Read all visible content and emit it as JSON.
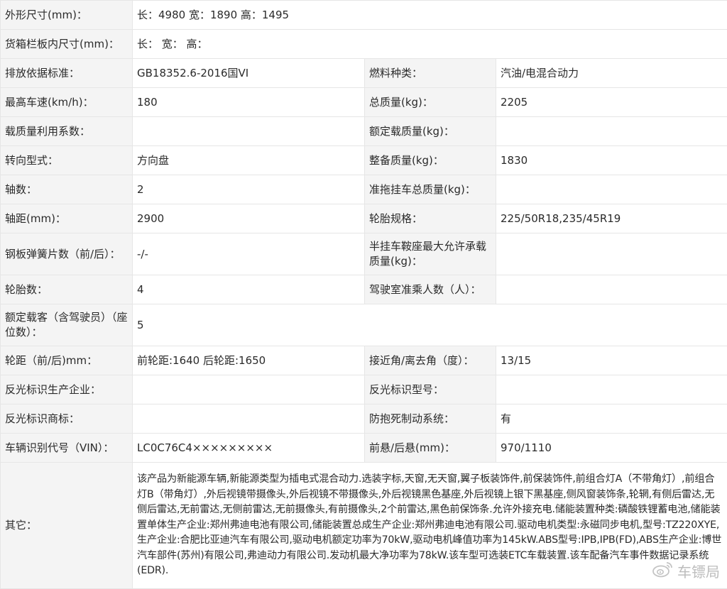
{
  "rows": [
    {
      "l1": "外形尺寸(mm)：",
      "v1": "长：4980 宽：1890 高：1495"
    },
    {
      "l1": "货箱栏板内尺寸(mm)：",
      "v1": "长：  宽：  高："
    },
    {
      "l1": "排放依据标准：",
      "v1": "GB18352.6-2016国VI",
      "l2": "燃料种类：",
      "v2": "汽油/电混合动力"
    },
    {
      "l1": "最高车速(km/h)：",
      "v1": "180",
      "l2": "总质量(kg)：",
      "v2": "2205"
    },
    {
      "l1": "载质量利用系数：",
      "v1": "",
      "l2": "额定载质量(kg)：",
      "v2": ""
    },
    {
      "l1": "转向型式：",
      "v1": "方向盘",
      "l2": "整备质量(kg)：",
      "v2": "1830"
    },
    {
      "l1": "轴数：",
      "v1": "2",
      "l2": "准拖挂车总质量(kg)：",
      "v2": ""
    },
    {
      "l1": "轴距(mm)：",
      "v1": "2900",
      "l2": "轮胎规格：",
      "v2": "225/50R18,235/45R19"
    },
    {
      "l1": "钢板弹簧片数（前/后）：",
      "v1": "-/-",
      "l2": "半挂车鞍座最大允许承载质量(kg)：",
      "v2": ""
    },
    {
      "l1": "轮胎数：",
      "v1": "4",
      "l2": "驾驶室准乘人数（人）：",
      "v2": ""
    },
    {
      "l1": "额定载客（含驾驶员）（座位数）：",
      "v1": "5"
    },
    {
      "l1": "轮距（前/后)mm：",
      "v1": "前轮距:1640 后轮距:1650",
      "l2": "接近角/离去角（度）：",
      "v2": "13/15"
    },
    {
      "l1": "反光标识生产企业：",
      "v1": "",
      "l2": "反光标识型号：",
      "v2": ""
    },
    {
      "l1": "反光标识商标：",
      "v1": "",
      "l2": "防抱死制动系统：",
      "v2": "有"
    },
    {
      "l1": "车辆识别代号（VIN）：",
      "v1": "LC0C76C4×××××××××",
      "l2": "前悬/后悬(mm)：",
      "v2": "970/1110"
    },
    {
      "l1": "其它：",
      "v1": "该产品为新能源车辆,新能源类型为插电式混合动力.选装字标,天窗,无天窗,翼子板装饰件,前保装饰件,前组合灯A（不带角灯）,前组合灯B（带角灯）,外后视镜带摄像头,外后视镜不带摄像头,外后视镜黑色基座,外后视镜上银下黑基座,侧风窗装饰条,轮辋,有侧后雷达,无侧后雷达,无前雷达,无侧前雷达,无前摄像头,有前摄像头,2个前雷达,黑色前保饰条.允许外接充电.储能装置种类:磷酸铁锂蓄电池,储能装置单体生产企业:郑州弗迪电池有限公司,储能装置总成生产企业:郑州弗迪电池有限公司.驱动电机类型:永磁同步电机,型号:TZ220XYE,生产企业:合肥比亚迪汽车有限公司,驱动电机额定功率为70kW,驱动电机峰值功率为145kW.ABS型号:IPB,IPB(FD),ABS生产企业:博世汽车部件(苏州)有限公司,弗迪动力有限公司.发动机最大净功率为78kW.该车型可选装ETC车载装置.该车配备汽车事件数据记录系统(EDR)."
    }
  ],
  "watermark": {
    "text": "车镖局",
    "icon": "weibo-icon"
  }
}
